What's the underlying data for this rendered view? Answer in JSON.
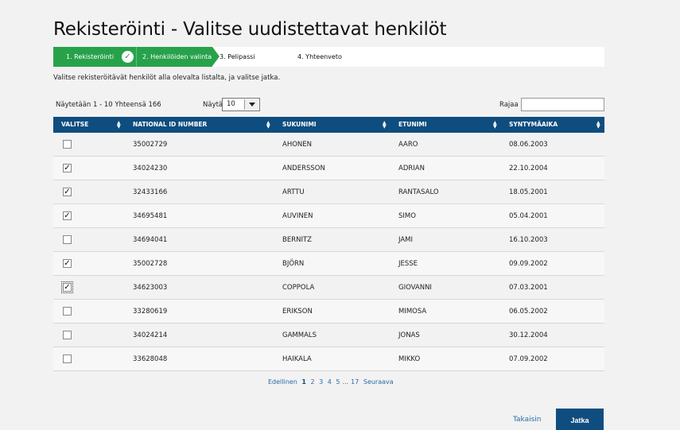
{
  "title": "Rekisteröinti - Valitse uudistettavat henkilöt",
  "stepper": {
    "steps": [
      {
        "label": "1. Rekisteröinti",
        "state": "done"
      },
      {
        "label": "2. Henkilöiden valinta",
        "state": "current"
      },
      {
        "label": "3. Pelipassi",
        "state": "upcoming"
      },
      {
        "label": "4. Yhteenveto",
        "state": "upcoming"
      }
    ],
    "done_icon": "check-icon",
    "accent_color": "#27a24a"
  },
  "intro": "Valitse rekisteröitävät henkilöt alla olevalta listalta, ja valitse jatka.",
  "table_controls": {
    "info": "Näytetään 1 - 10 Yhteensä 166",
    "length_label": "Näytä",
    "length_value": "10",
    "filter_label": "Rajaa",
    "filter_value": ""
  },
  "table": {
    "header_color": "#0f4d7f",
    "columns": [
      "VALITSE",
      "NATIONAL ID NUMBER",
      "SUKUNIMI",
      "ETUNIMI",
      "SYNTYMÄAIKA"
    ],
    "rows": [
      {
        "checked": false,
        "id": "35002729",
        "last": "AHONEN",
        "first": "AARO",
        "dob": "08.06.2003"
      },
      {
        "checked": true,
        "id": "34024230",
        "last": "ANDERSSON",
        "first": "ADRIAN",
        "dob": "22.10.2004"
      },
      {
        "checked": true,
        "id": "32433166",
        "last": "ARTTU",
        "first": "RANTASALO",
        "dob": "18.05.2001"
      },
      {
        "checked": true,
        "id": "34695481",
        "last": "AUVINEN",
        "first": "SIMO",
        "dob": "05.04.2001"
      },
      {
        "checked": false,
        "id": "34694041",
        "last": "BERNITZ",
        "first": "JAMI",
        "dob": "16.10.2003"
      },
      {
        "checked": true,
        "id": "35002728",
        "last": "BJÖRN",
        "first": "JESSE",
        "dob": "09.09.2002"
      },
      {
        "checked": true,
        "id": "34623003",
        "last": "COPPOLA",
        "first": "GIOVANNI",
        "dob": "07.03.2001"
      },
      {
        "checked": false,
        "id": "33280619",
        "last": "ERIKSON",
        "first": "MIMOSA",
        "dob": "06.05.2002"
      },
      {
        "checked": false,
        "id": "34024214",
        "last": "GAMMALS",
        "first": "JONAS",
        "dob": "30.12.2004"
      },
      {
        "checked": false,
        "id": "33628048",
        "last": "HAIKALA",
        "first": "MIKKO",
        "dob": "07.09.2002"
      }
    ]
  },
  "pagination": {
    "prev": "Edellinen",
    "pages": [
      "1",
      "2",
      "3",
      "4",
      "5"
    ],
    "ellipsis": "...",
    "last": "17",
    "next": "Seuraava",
    "current": "1"
  },
  "footer": {
    "back_label": "Takaisin",
    "next_label": "Jatka"
  }
}
